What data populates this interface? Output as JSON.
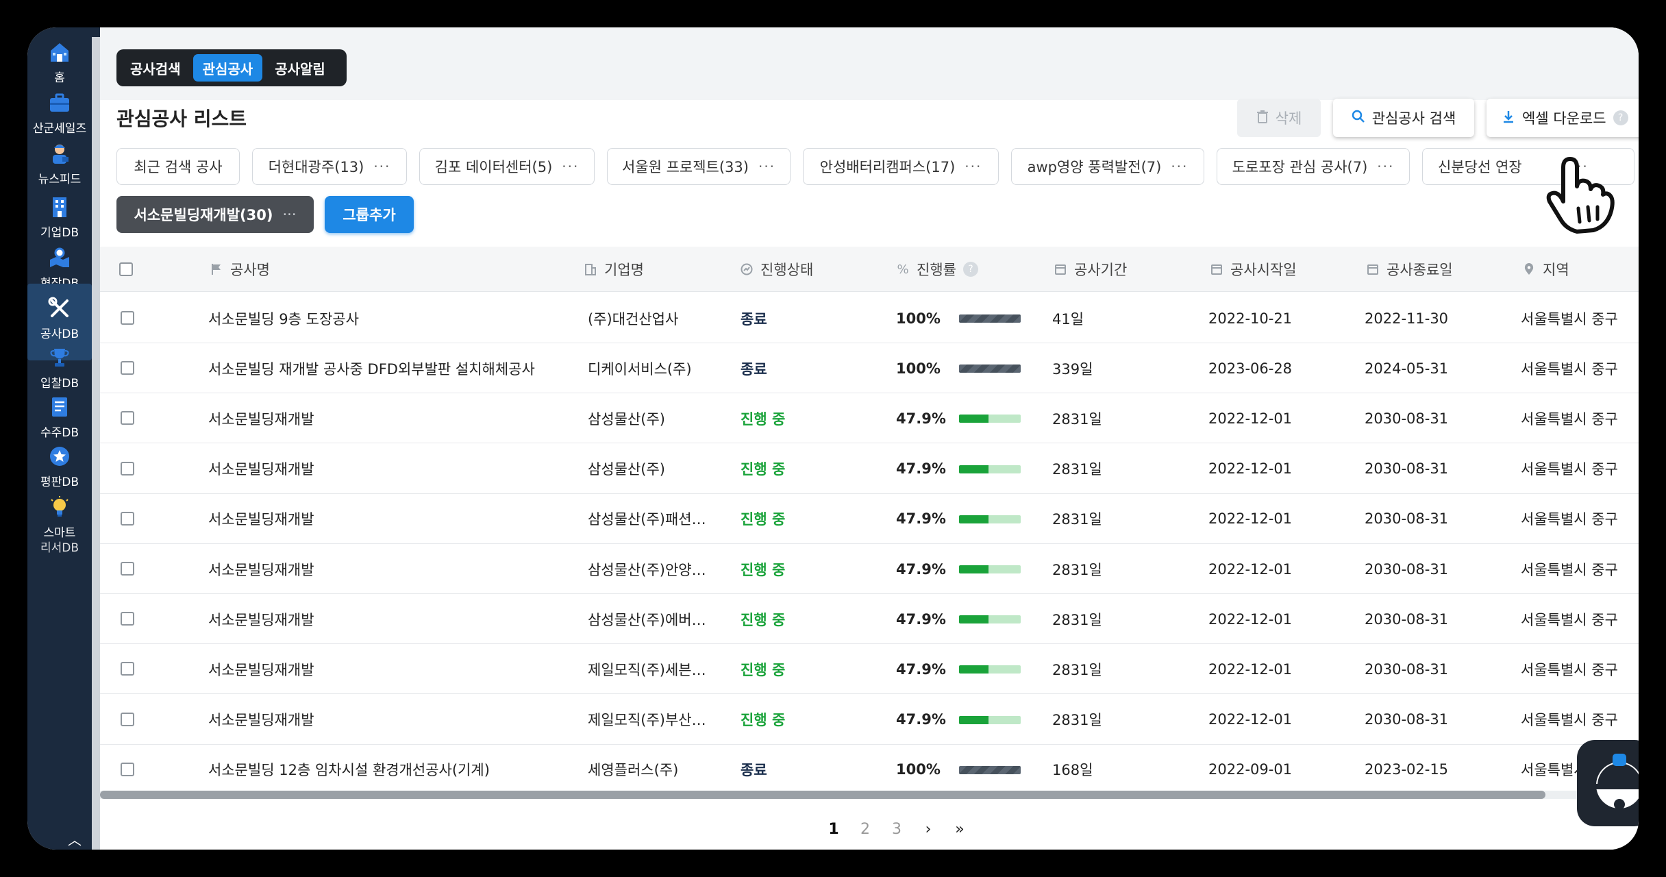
{
  "sidebar": {
    "items": [
      {
        "label": "홈",
        "icon": "home-icon"
      },
      {
        "label": "산군세일즈",
        "icon": "briefcase-icon"
      },
      {
        "label": "뉴스피드",
        "icon": "reporter-icon"
      },
      {
        "label": "기업DB",
        "icon": "building-icon"
      },
      {
        "label": "현장DB",
        "icon": "site-map-icon"
      },
      {
        "label": "공사DB",
        "icon": "tools-icon",
        "active": true
      },
      {
        "label": "입찰DB",
        "icon": "trophy-icon"
      },
      {
        "label": "수주DB",
        "icon": "document-icon"
      },
      {
        "label": "평판DB",
        "icon": "star-badge-icon"
      },
      {
        "label": "스마트",
        "icon": "lightbulb-icon"
      }
    ],
    "partial_label": "리서DB",
    "scroll_up": "︿"
  },
  "tabs": {
    "items": [
      "공사검색",
      "관심공사",
      "공사알림"
    ],
    "active": "관심공사"
  },
  "list": {
    "title": "관심공사 리스트"
  },
  "toolbar": {
    "delete_label": "삭제",
    "search_label": "관심공사 검색",
    "excel_label": "엑셀 다운로드",
    "help_mark": "?"
  },
  "groups": {
    "items": [
      "최근 검색 공사",
      "더현대광주(13)",
      "김포 데이터센터(5)",
      "서울원 프로젝트(33)",
      "안성배터리캠퍼스(17)",
      "awp영양 풍력발전(7)",
      "도로포장 관심 공사(7)",
      "신분당선 연장"
    ],
    "selected": "서소문빌딩재개발(30)",
    "add_label": "그룹추가",
    "more": "···"
  },
  "table": {
    "headers": {
      "name": "공사명",
      "company": "기업명",
      "status": "진행상태",
      "rate": "진행률",
      "period": "공사기간",
      "start": "공사시작일",
      "end": "공사종료일",
      "region": "지역"
    },
    "rows": [
      {
        "name": "서소문빌딩 9층 도장공사",
        "company": "(주)대건산업사",
        "status": "종료",
        "rate": "100%",
        "progress": 1.0,
        "period": "41일",
        "start": "2022-10-21",
        "end": "2022-11-30",
        "region": "서울특별시 중구"
      },
      {
        "name": "서소문빌딩 재개발 공사중 DFD외부발판 설치해체공사",
        "company": "디케이서비스(주)",
        "status": "종료",
        "rate": "100%",
        "progress": 1.0,
        "period": "339일",
        "start": "2023-06-28",
        "end": "2024-05-31",
        "region": "서울특별시 중구"
      },
      {
        "name": "서소문빌딩재개발",
        "company": "삼성물산(주)",
        "status": "진행 중",
        "rate": "47.9%",
        "progress": 0.479,
        "period": "2831일",
        "start": "2022-12-01",
        "end": "2030-08-31",
        "region": "서울특별시 중구"
      },
      {
        "name": "서소문빌딩재개발",
        "company": "삼성물산(주)",
        "status": "진행 중",
        "rate": "47.9%",
        "progress": 0.479,
        "period": "2831일",
        "start": "2022-12-01",
        "end": "2030-08-31",
        "region": "서울특별시 중구"
      },
      {
        "name": "서소문빌딩재개발",
        "company": "삼성물산(주)패션…",
        "status": "진행 중",
        "rate": "47.9%",
        "progress": 0.479,
        "period": "2831일",
        "start": "2022-12-01",
        "end": "2030-08-31",
        "region": "서울특별시 중구"
      },
      {
        "name": "서소문빌딩재개발",
        "company": "삼성물산(주)안양…",
        "status": "진행 중",
        "rate": "47.9%",
        "progress": 0.479,
        "period": "2831일",
        "start": "2022-12-01",
        "end": "2030-08-31",
        "region": "서울특별시 중구"
      },
      {
        "name": "서소문빌딩재개발",
        "company": "삼성물산(주)에버…",
        "status": "진행 중",
        "rate": "47.9%",
        "progress": 0.479,
        "period": "2831일",
        "start": "2022-12-01",
        "end": "2030-08-31",
        "region": "서울특별시 중구"
      },
      {
        "name": "서소문빌딩재개발",
        "company": "제일모직(주)세븐…",
        "status": "진행 중",
        "rate": "47.9%",
        "progress": 0.479,
        "period": "2831일",
        "start": "2022-12-01",
        "end": "2030-08-31",
        "region": "서울특별시 중구"
      },
      {
        "name": "서소문빌딩재개발",
        "company": "제일모직(주)부산…",
        "status": "진행 중",
        "rate": "47.9%",
        "progress": 0.479,
        "period": "2831일",
        "start": "2022-12-01",
        "end": "2030-08-31",
        "region": "서울특별시 중구"
      },
      {
        "name": "서소문빌딩 12층 임차시설 환경개선공사(기계)",
        "company": "세영플러스(주)",
        "status": "종료",
        "rate": "100%",
        "progress": 1.0,
        "period": "168일",
        "start": "2022-09-01",
        "end": "2023-02-15",
        "region": "서울특별시 중구"
      }
    ]
  },
  "pagination": {
    "pages": [
      "1",
      "2",
      "3"
    ],
    "current": "1",
    "next": "›",
    "last": "»"
  },
  "colors": {
    "accent": "#1e88e5",
    "sidebar": "#1b2a3e",
    "in_progress": "#1aa33a",
    "done": "#1b2f4d"
  }
}
